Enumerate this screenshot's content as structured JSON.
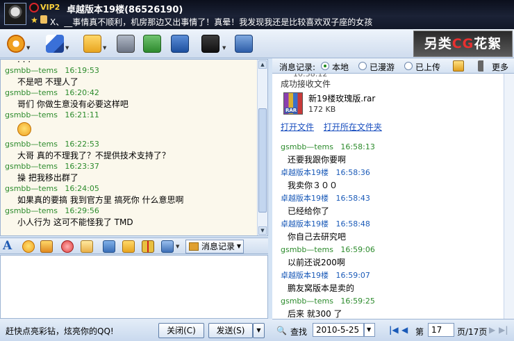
{
  "title_bar": {
    "vip_badge": "VIP2",
    "contact_name": "卓越版本19楼(86526190)",
    "signature": "X、__事情真不顺利，机房那边又出事情了！真晕！我发现我还是比较喜欢双子座的女孩"
  },
  "toolbar": {
    "ad_banner_prefix": "另类",
    "ad_banner_cg": "CG",
    "ad_banner_suffix": "花絮"
  },
  "history": {
    "partial_line": "· · ·",
    "messages": [
      {
        "sender": "gsmbb—tems",
        "time": "16:19:53",
        "text": "不是吧 不理人了"
      },
      {
        "sender": "gsmbb—tems",
        "time": "16:20:42",
        "text": "哥们 你做生意没有必要这样吧"
      },
      {
        "sender": "gsmbb—tems",
        "time": "16:21:11",
        "text": ""
      },
      {
        "sender": "gsmbb—tems",
        "time": "16:22:53",
        "text": "大哥 真的不理我了？不提供技术支持了？"
      },
      {
        "sender": "gsmbb—tems",
        "time": "16:23:37",
        "text": "操 把我移出群了"
      },
      {
        "sender": "gsmbb—tems",
        "time": "16:24:05",
        "text": "如果真的要搞 我到官方里 搞死你 什么意思啊"
      },
      {
        "sender": "gsmbb—tems",
        "time": "16:29:56",
        "text": "小人行为 这可不能怪我了 TMD"
      }
    ]
  },
  "input_toolbar": {
    "font_glyph": "A",
    "record_button": "消息记录"
  },
  "bottom": {
    "ad_text": "赶快点亮彩钻，炫亮你的QQ!",
    "close_button": "关闭(C)",
    "send_button": "发送(S)"
  },
  "record_header": {
    "label": "消息记录:",
    "options": [
      "本地",
      "已漫游",
      "已上传"
    ],
    "selected": "本地",
    "more": "更多"
  },
  "record": {
    "partial_time": "10:58:12",
    "file_received": "成功接收文件",
    "file_name": "新19楼玫瑰版.rar",
    "file_size": "172 KB",
    "open_file": "打开文件",
    "open_folder": "打开所在文件夹",
    "messages": [
      {
        "sender": "gsmbb—tems",
        "time": "16:58:13",
        "text": "还要我跟你要啊",
        "side": "other"
      },
      {
        "sender": "卓越版本19楼",
        "time": "16:58:36",
        "text": "我卖你３００",
        "side": "self"
      },
      {
        "sender": "卓越版本19楼",
        "time": "16:58:43",
        "text": "已经给你了",
        "side": "self"
      },
      {
        "sender": "卓越版本19楼",
        "time": "16:58:48",
        "text": "你自己去研究吧",
        "side": "self"
      },
      {
        "sender": "gsmbb—tems",
        "time": "16:59:06",
        "text": "以前还说200啊",
        "side": "other"
      },
      {
        "sender": "卓越版本19楼",
        "time": "16:59:07",
        "text": "鹏友窝版本是卖的",
        "side": "self"
      },
      {
        "sender": "gsmbb—tems",
        "time": "16:59:25",
        "text": "后来 就300 了",
        "side": "other"
      }
    ]
  },
  "pager": {
    "search": "查找",
    "date": "2010-5-25",
    "page_prefix": "第",
    "page_number": "17",
    "page_suffix": "页/17页"
  },
  "colors": {
    "title_bg": "#121828",
    "toolbar_bg": "#cfdcee",
    "history_bg": "#fbf8ec",
    "sender_green": "#2c8b2c",
    "sender_blue": "#1a5ab8",
    "link": "#1a4fbf"
  }
}
